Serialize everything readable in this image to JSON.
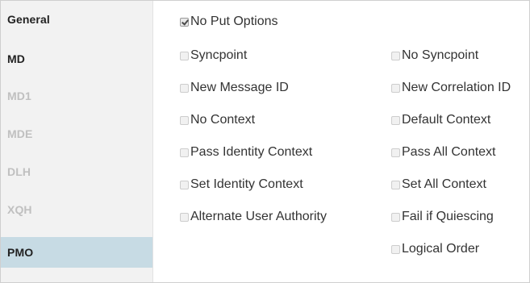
{
  "sidebar": {
    "items": [
      {
        "label": "General"
      },
      {
        "label": "MD"
      },
      {
        "label": "MD1"
      },
      {
        "label": "MDE"
      },
      {
        "label": "DLH"
      },
      {
        "label": "XQH"
      },
      {
        "label": "PMO"
      }
    ],
    "active": "PMO"
  },
  "options": {
    "no_put_options": {
      "label": "No Put Options",
      "checked": true
    },
    "syncpoint": {
      "label": "Syncpoint",
      "checked": false
    },
    "no_syncpoint": {
      "label": "No Syncpoint",
      "checked": false
    },
    "new_message_id": {
      "label": "New Message ID",
      "checked": false
    },
    "new_correlation_id": {
      "label": "New Correlation ID",
      "checked": false
    },
    "no_context": {
      "label": "No Context",
      "checked": false
    },
    "default_context": {
      "label": "Default Context",
      "checked": false
    },
    "pass_identity_context": {
      "label": "Pass Identity Context",
      "checked": false
    },
    "pass_all_context": {
      "label": "Pass All Context",
      "checked": false
    },
    "set_identity_context": {
      "label": "Set Identity Context",
      "checked": false
    },
    "set_all_context": {
      "label": "Set All Context",
      "checked": false
    },
    "alternate_user_authority": {
      "label": "Alternate User Authority",
      "checked": false
    },
    "fail_if_quiescing": {
      "label": "Fail if Quiescing",
      "checked": false
    },
    "logical_order": {
      "label": "Logical Order",
      "checked": false
    }
  },
  "colors": {
    "sidebar_bg": "#f2f2f2",
    "active_bg": "#c7dbe4",
    "inactive_text": "#c0c0c0",
    "active_text": "#222222"
  }
}
